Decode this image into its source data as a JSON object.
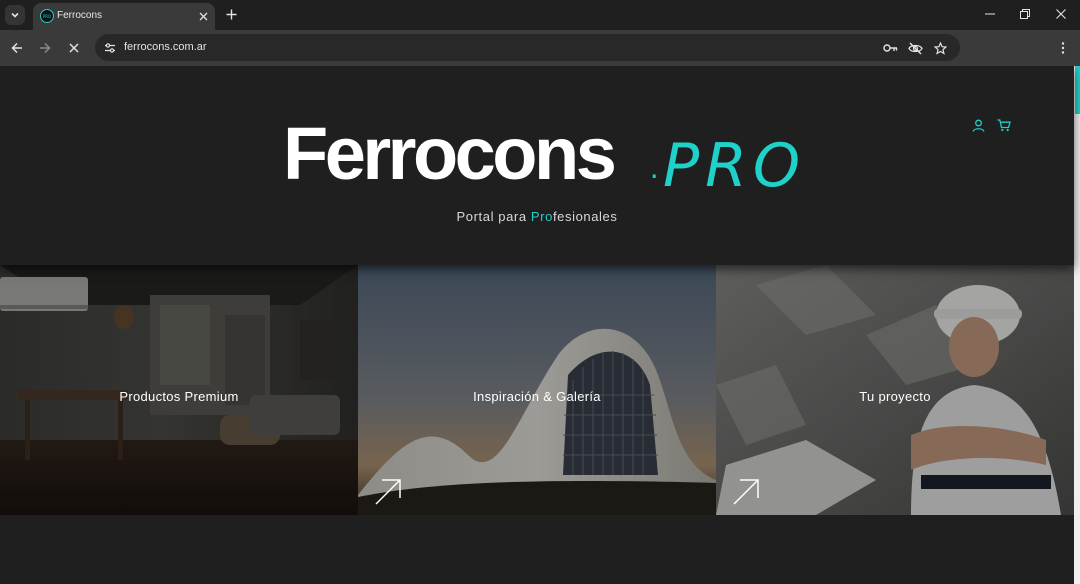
{
  "browser": {
    "tab_title": "Ferrocons",
    "favicon_text": "PRO",
    "url": "ferrocons.com.ar"
  },
  "header": {
    "logo_main": "Ferrocons",
    "logo_dot": ".",
    "logo_suffix": "PRO",
    "tagline_before": "Portal para ",
    "tagline_highlight": "Pro",
    "tagline_after": "fesionales"
  },
  "cards": [
    {
      "label": "Productos Premium"
    },
    {
      "label": "Inspiración & Galería"
    },
    {
      "label": "Tu proyecto"
    }
  ],
  "colors": {
    "accent": "#1fd1c8",
    "background": "#1f1f1f",
    "text": "#ffffff"
  },
  "icons": {
    "header": [
      "user-icon",
      "cart-icon"
    ],
    "card": "arrow-up-right-icon"
  }
}
